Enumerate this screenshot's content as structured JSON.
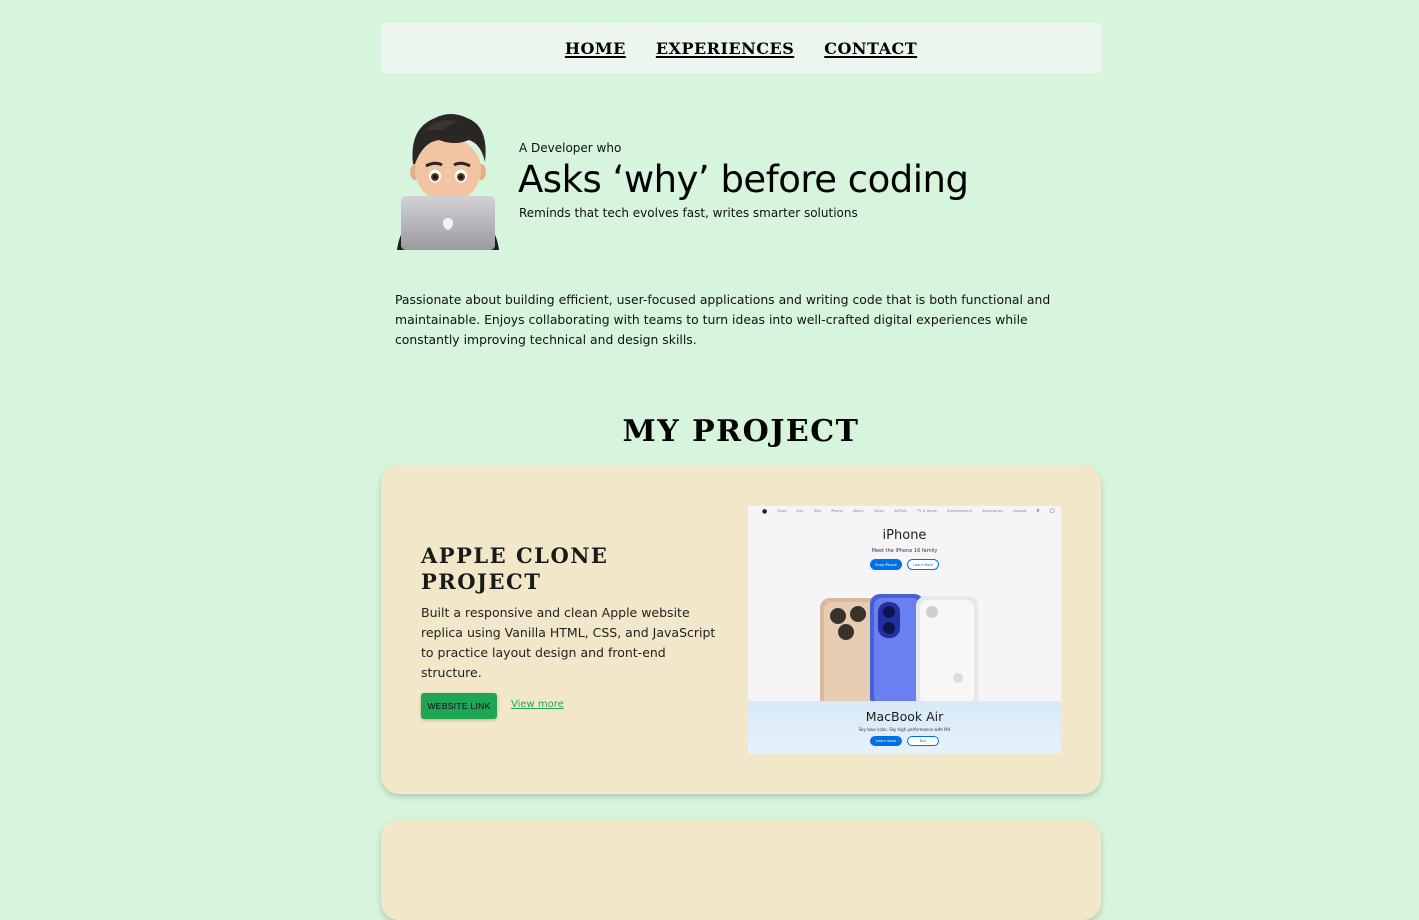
{
  "nav": {
    "items": [
      {
        "label": "HOME"
      },
      {
        "label": "EXPERIENCES"
      },
      {
        "label": "CONTACT"
      }
    ]
  },
  "hero": {
    "intro": "A Developer who",
    "title": "Asks ‘why’ before coding",
    "subtitle": "Reminds that tech evolves fast, writes smarter solutions"
  },
  "about": {
    "text": "Passionate about building efficient, user-focused applications and writing code that is both functional and maintainable. Enjoys collaborating with teams to turn ideas into well-crafted digital experiences while constantly improving technical and design skills."
  },
  "projects": {
    "section_title": "MY PROJECT",
    "items": [
      {
        "title": "APPLE CLONE PROJECT",
        "description": "Built a responsive and clean Apple website replica using Vanilla HTML, CSS, and JavaScript to practice layout design and front-end structure.",
        "website_button": "WEBSITE LINK",
        "view_more": "View more",
        "screenshot": {
          "nav_items": [
            "Store",
            "Mac",
            "iPad",
            "iPhone",
            "Watch",
            "Vision",
            "AirPods",
            "TV & Home",
            "Entertainment",
            "Accessories",
            "Support"
          ],
          "top_title": "iPhone",
          "top_subtitle": "Meet the iPhone 16 family",
          "shop_button": "Shop iPhone",
          "learn_button": "Learn More",
          "bottom_title": "MacBook Air",
          "bottom_subtitle": "Sky blue color. Sky high performance with M4",
          "bottom_learn": "Learn more",
          "bottom_buy": "Buy"
        }
      }
    ]
  },
  "colors": {
    "background": "#d6f5dc",
    "nav_bg": "#ecf6ee",
    "card_bg": "#f2e8c9",
    "accent_green": "#1fa653"
  }
}
